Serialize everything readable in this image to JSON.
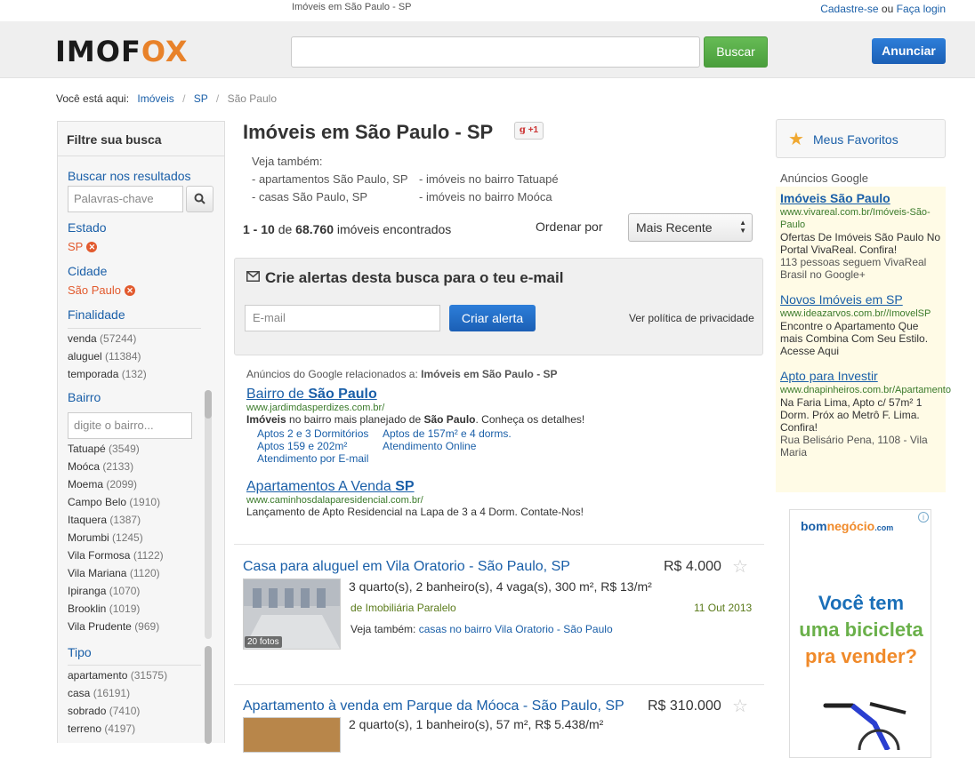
{
  "top": {
    "page_title": "Imóveis em São Paulo - SP",
    "signup": "Cadastre-se",
    "or": "ou",
    "login": "Faça login"
  },
  "header": {
    "logo_a": "IMOF",
    "logo_b": "O",
    "logo_c": "X",
    "search_placeholder": "",
    "search_button": "Buscar",
    "post_button": "Anunciar"
  },
  "breadcrumb": {
    "label": "Você está aqui:",
    "items": [
      "Imóveis",
      "SP",
      "São Paulo"
    ]
  },
  "filters": {
    "title": "Filtre sua busca",
    "search_label": "Buscar nos resultados",
    "keyword_placeholder": "Palavras-chave",
    "estado_label": "Estado",
    "estado_value": "SP",
    "cidade_label": "Cidade",
    "cidade_value": "São Paulo",
    "finalidade_label": "Finalidade",
    "finalidade": [
      {
        "name": "venda",
        "count": "(57244)"
      },
      {
        "name": "aluguel",
        "count": "(11384)"
      },
      {
        "name": "temporada",
        "count": "(132)"
      }
    ],
    "bairro_label": "Bairro",
    "bairro_placeholder": "digite o bairro...",
    "bairros": [
      {
        "name": "Tatuapé",
        "count": "(3549)"
      },
      {
        "name": "Moóca",
        "count": "(2133)"
      },
      {
        "name": "Moema",
        "count": "(2099)"
      },
      {
        "name": "Campo Belo",
        "count": "(1910)"
      },
      {
        "name": "Itaquera",
        "count": "(1387)"
      },
      {
        "name": "Morumbi",
        "count": "(1245)"
      },
      {
        "name": "Vila Formosa",
        "count": "(1122)"
      },
      {
        "name": "Vila Mariana",
        "count": "(1120)"
      },
      {
        "name": "Ipiranga",
        "count": "(1070)"
      },
      {
        "name": "Brooklin",
        "count": "(1019)"
      },
      {
        "name": "Vila Prudente",
        "count": "(969)"
      }
    ],
    "tipo_label": "Tipo",
    "tipos": [
      {
        "name": "apartamento",
        "count": "(31575)"
      },
      {
        "name": "casa",
        "count": "(16191)"
      },
      {
        "name": "sobrado",
        "count": "(7410)"
      },
      {
        "name": "terreno",
        "count": "(4197)"
      }
    ]
  },
  "main": {
    "title": "Imóveis em São Paulo - SP",
    "gplus": "+1",
    "see_also_label": "Veja também:",
    "see_also": [
      "- apartamentos São Paulo, SP",
      "- imóveis no bairro Tatuapé",
      "- casas São Paulo, SP",
      "- imóveis no bairro Moóca"
    ],
    "count_range": "1 - 10",
    "count_of": "de",
    "count_total": "68.760",
    "count_suffix": "imóveis encontrados",
    "order_label": "Ordenar por",
    "order_value": "Mais Recente",
    "alert_title": "Crie alertas desta busca para o teu e-mail",
    "email_placeholder": "E-mail",
    "alert_button": "Criar alerta",
    "privacy": "Ver política de privacidade",
    "ads_label": "Anúncios do Google relacionados a:",
    "ads_query": "Imóveis em São Paulo - SP",
    "ads": [
      {
        "title_a": "Bairro de ",
        "title_b": "São Paulo",
        "url": "www.jardimdasperdizes.com.br/",
        "text_a": "Imóveis",
        "text_b": " no bairro mais planejado de ",
        "text_c": "São Paulo",
        "text_d": ". Conheça os detalhes!",
        "links": [
          "Aptos 2 e 3 Dormitórios",
          "Aptos de 157m² e 4 dorms.",
          "Aptos 159 e 202m²",
          "Atendimento Online",
          "Atendimento por E-mail"
        ]
      },
      {
        "title_a": "Apartamentos A Venda ",
        "title_b": "SP",
        "url": "www.caminhosdalaparesidencial.com.br/",
        "text": "Lançamento de Apto Residencial na Lapa de 3 a 4 Dorm. Contate-Nos!"
      }
    ],
    "listings": [
      {
        "title": "Casa para aluguel em Vila Oratorio - São Paulo, SP",
        "price": "R$ 4.000",
        "desc": "3 quarto(s), 2 banheiro(s), 4 vaga(s), 300 m², R$ 13/m²",
        "agency": "de Imobiliária Paralelo",
        "date": "11 Out 2013",
        "see_label": "Veja também:",
        "see_link": "casas no bairro Vila Oratorio - São Paulo",
        "photos": "20 fotos"
      },
      {
        "title": "Apartamento à venda em Parque da Móoca - São Paulo, SP",
        "price": "R$ 310.000",
        "desc": "2 quarto(s), 1 banheiro(s), 57 m², R$ 5.438/m²"
      }
    ]
  },
  "right": {
    "fav": "Meus Favoritos",
    "ads_label": "Anúncios Google",
    "ads": [
      {
        "title": "Imóveis São Paulo",
        "url": "www.vivareal.com.br/Imóveis-São-Paulo",
        "text": "Ofertas De Imóveis São Paulo No Portal VivaReal. Confira!",
        "extra": "113 pessoas seguem VivaReal Brasil no Google+"
      },
      {
        "title": "Novos Imóveis em SP",
        "url": "www.ideazarvos.com.br//ImovelSP",
        "text": "Encontre o Apartamento Que mais Combina Com Seu Estilo. Acesse Aqui"
      },
      {
        "title": "Apto para Investir",
        "url": "www.dnapinheiros.com.br/Apartamento",
        "text": "Na Faria Lima, Apto c/ 57m² 1 Dorm. Próx ao Metrô F. Lima. Confira!",
        "extra": "Rua Belisário Pena, 1108 - Vila Maria"
      }
    ],
    "banner": {
      "logo_a": "bom",
      "logo_b": "negócio",
      "logo_c": ".com",
      "line1": "Você tem",
      "line2": "uma bicicleta",
      "line3": "pra vender?"
    }
  },
  "colors": {
    "accent": "#1a5fa8",
    "green": "#4a9e3c",
    "orange": "#e25a2e"
  }
}
